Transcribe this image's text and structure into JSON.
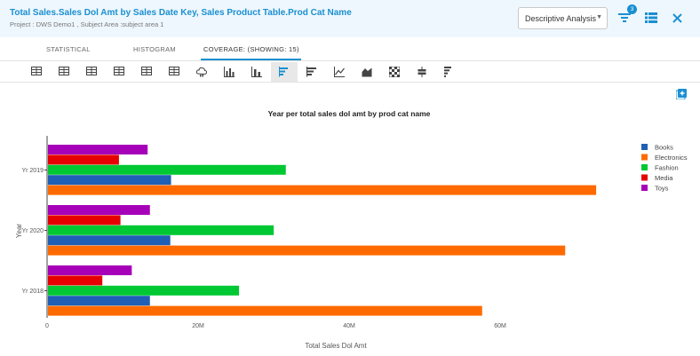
{
  "header": {
    "title": "Total Sales.Sales Dol Amt by Sales Date Key, Sales Product Table.Prod Cat Name",
    "subtitle": "Project : DWS Demo1 ,  Subject Area :subject area 1",
    "analysis_select": "Descriptive Analysis",
    "filter_badge": "3",
    "filter_icon": "filter-icon",
    "list_icon": "list-icon",
    "close_icon": "close-icon"
  },
  "tabs": [
    {
      "label": "STATISTICAL"
    },
    {
      "label": "HISTOGRAM"
    },
    {
      "label": "COVERAGE: (SHOWING: 15)",
      "active": true
    }
  ],
  "toolbar": {
    "icons": [
      "table-icon",
      "table-icon",
      "table-icon",
      "table-icon",
      "table-icon",
      "table-icon",
      "cloud-chart-icon",
      "bar-chart-icon",
      "stacked-bar-icon",
      "horizontal-bar-icon",
      "horizontal-stacked-bar-icon",
      "line-chart-icon",
      "area-chart-icon",
      "heatmap-icon",
      "boxplot-icon",
      "funnel-chart-icon"
    ],
    "active_index": 9
  },
  "colors": {
    "accent": "#1a8fd1",
    "Books": "#1f5fb5",
    "Electronics": "#ff6a00",
    "Fashion": "#00c832",
    "Media": "#e60000",
    "Toys": "#a600b9"
  },
  "chart_data": {
    "type": "bar",
    "orientation": "horizontal",
    "title": "Year per total sales dol amt by prod cat name",
    "xlabel": "Total Sales Dol Amt",
    "ylabel": "Year",
    "categories": [
      "Yr 2019",
      "Yr 2020",
      "Yr 2018"
    ],
    "series": [
      {
        "name": "Books",
        "values": [
          16.3,
          16.2,
          13.5
        ]
      },
      {
        "name": "Electronics",
        "values": [
          72.6,
          68.5,
          57.5
        ]
      },
      {
        "name": "Fashion",
        "values": [
          31.5,
          29.9,
          25.3
        ]
      },
      {
        "name": "Media",
        "values": [
          9.4,
          9.6,
          7.2
        ]
      },
      {
        "name": "Toys",
        "values": [
          13.2,
          13.5,
          11.1
        ]
      }
    ],
    "units": "M",
    "xlim": [
      0,
      74
    ],
    "xticks": [
      0,
      20,
      40,
      60
    ],
    "xtick_labels": [
      "0",
      "20M",
      "40M",
      "60M"
    ],
    "legend_position": "top-right",
    "grid": false
  }
}
